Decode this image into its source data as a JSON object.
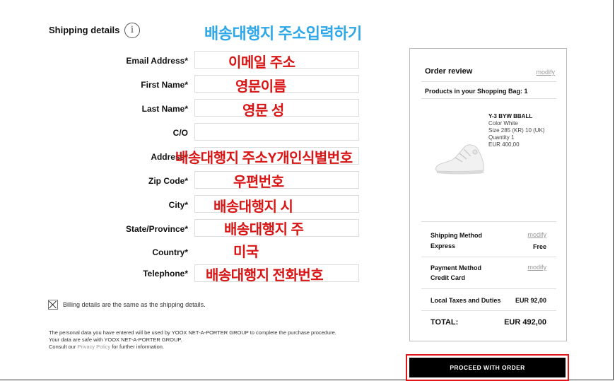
{
  "header": {
    "title": "Shipping details",
    "info_icon_glyph": "i",
    "annotation": "배송대행지 주소입력하기"
  },
  "form": {
    "fields": [
      {
        "label": "Email Address*",
        "annotation": "이메일 주소"
      },
      {
        "label": "First Name*",
        "annotation": "영문이름"
      },
      {
        "label": "Last Name*",
        "annotation": "영문 성"
      },
      {
        "label": "C/O",
        "annotation": ""
      },
      {
        "label": "Address*",
        "annotation": "배송대행지 주소Y개인식별번호"
      },
      {
        "label": "Zip Code*",
        "annotation": "우편번호"
      },
      {
        "label": "City*",
        "annotation": "배송대행지 시"
      },
      {
        "label": "State/Province*",
        "annotation": "배송대행지 주"
      },
      {
        "label": "Country*",
        "annotation": "미국"
      },
      {
        "label": "Telephone*",
        "annotation": "배송대행지 전화번호"
      }
    ],
    "billing_same": {
      "checked": true,
      "label": "Billing details are the same as the shipping details."
    },
    "privacy": {
      "line1": "The personal data you have entered will be used by YOOX NET-A-PORTER GROUP to complete the purchase procedure.",
      "line2": "Your data are safe with YOOX NET-A-PORTER GROUP.",
      "line3_prefix": "Consult our ",
      "line3_link": "Privacy Policy",
      "line3_suffix": " for further information."
    }
  },
  "order_review": {
    "title": "Order review",
    "modify_label": "modify",
    "bag_text": "Products in your Shopping Bag: 1",
    "product": {
      "name": "Y-3 BYW BBALL",
      "color": "Color  White",
      "size": "Size  285 (KR) 10 (UK)",
      "quantity": "Quantity  1",
      "price": "EUR 400,00",
      "image_icon": "sneaker-icon"
    },
    "shipping_method": {
      "label": "Shipping Method",
      "value_label": "Express",
      "value": "Free"
    },
    "payment_method": {
      "label": "Payment Method",
      "value": "Credit Card"
    },
    "taxes": {
      "label": "Local Taxes and Duties",
      "value": "EUR 92,00"
    },
    "total": {
      "label": "TOTAL:",
      "value": "EUR 492,00"
    }
  },
  "actions": {
    "proceed_label": "PROCEED WITH ORDER",
    "highlight_color": "#e01818"
  },
  "colors": {
    "annotation_red": "#d81414",
    "annotation_blue": "#2ea7e8"
  }
}
